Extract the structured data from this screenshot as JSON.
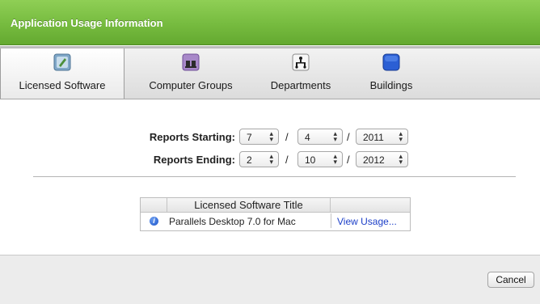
{
  "window": {
    "title": "Application Usage Information"
  },
  "tabs": [
    {
      "label": "Licensed Software",
      "icon": "licensed-software-icon",
      "selected": true
    },
    {
      "label": "Computer Groups",
      "icon": "computer-groups-icon",
      "selected": false
    },
    {
      "label": "Departments",
      "icon": "departments-icon",
      "selected": false
    },
    {
      "label": "Buildings",
      "icon": "buildings-icon",
      "selected": false
    }
  ],
  "reports": {
    "starting_label": "Reports Starting:",
    "starting_month": "7",
    "starting_day": "4",
    "starting_year": "2011",
    "ending_label": "Reports Ending:",
    "ending_month": "2",
    "ending_day": "10",
    "ending_year": "2012",
    "separator": "/"
  },
  "software_table": {
    "header": "Licensed Software Title",
    "rows": [
      {
        "title": "Parallels Desktop 7.0 for Mac",
        "action": "View Usage..."
      }
    ]
  },
  "footer": {
    "cancel_label": "Cancel"
  },
  "colors": {
    "title_bar": "#76bb3f",
    "link": "#1c3fc8",
    "info_icon": "#1b53c9"
  }
}
